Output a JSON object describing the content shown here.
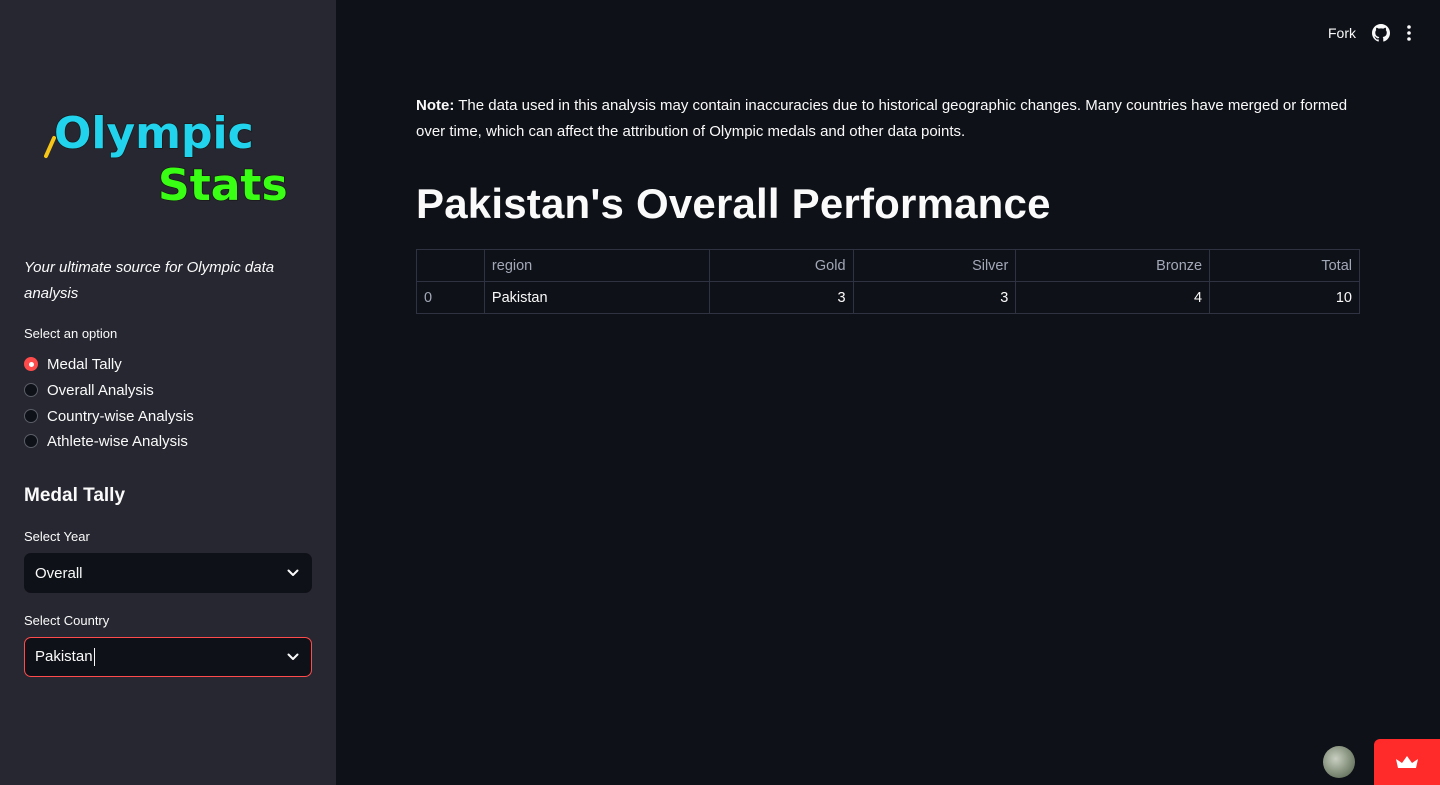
{
  "sidebar": {
    "logo_line1": "Olympic",
    "logo_line2": "Stats",
    "tagline": "Your ultimate source for Olympic data analysis",
    "option_label": "Select an option",
    "options": [
      {
        "label": "Medal Tally",
        "selected": true
      },
      {
        "label": "Overall Analysis",
        "selected": false
      },
      {
        "label": "Country-wise Analysis",
        "selected": false
      },
      {
        "label": "Athlete-wise Analysis",
        "selected": false
      }
    ],
    "section_heading": "Medal Tally",
    "year_label": "Select Year",
    "year_value": "Overall",
    "country_label": "Select Country",
    "country_value": "Pakistan"
  },
  "header": {
    "fork_label": "Fork",
    "icons": [
      "github-icon",
      "more-vertical-icon"
    ]
  },
  "main": {
    "note_label": "Note:",
    "note_text": " The data used in this analysis may contain inaccuracies due to historical geographic changes. Many countries have merged or formed over time, which can affect the attribution of Olympic medals and other data points.",
    "title": "Pakistan's Overall Performance",
    "table": {
      "columns": [
        "",
        "region",
        "Gold",
        "Silver",
        "Bronze",
        "Total"
      ],
      "rows": [
        [
          "0",
          "Pakistan",
          "3",
          "3",
          "4",
          "10"
        ]
      ]
    }
  },
  "colors": {
    "background": "#0e1117",
    "sidebar": "#262730",
    "accent": "#ff4b4b",
    "logo_cyan": "#22d3ee",
    "logo_green": "#39ff14"
  }
}
